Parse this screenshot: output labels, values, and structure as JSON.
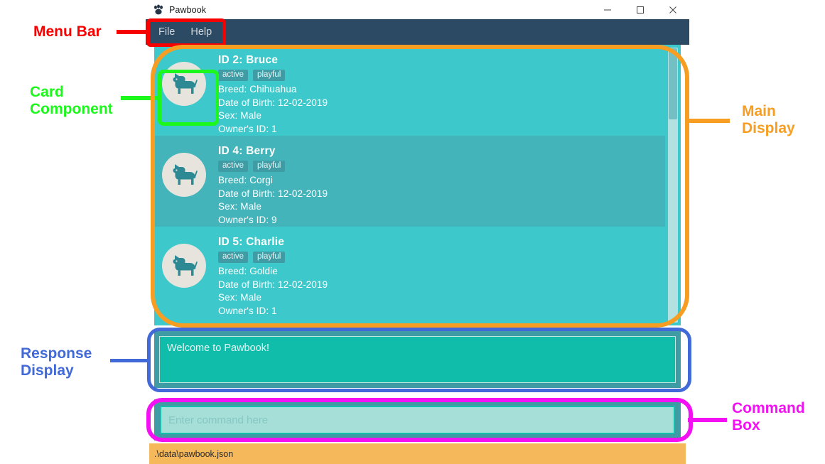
{
  "window": {
    "title": "Pawbook",
    "icon": "paw-icon",
    "controls": {
      "minimize": "–",
      "maximize": "☐",
      "close": "✕"
    }
  },
  "menu_bar": {
    "items": [
      {
        "label": "File"
      },
      {
        "label": "Help"
      }
    ]
  },
  "main_display": {
    "cards": [
      {
        "title": "ID 2:  Bruce",
        "tags": [
          "active",
          "playful"
        ],
        "breed": "Breed: Chihuahua",
        "dob": "Date of Birth: 12-02-2019",
        "sex": "Sex: Male",
        "owner": "Owner's ID: 1",
        "avatar": "dog-icon"
      },
      {
        "title": "ID 4:  Berry",
        "tags": [
          "active",
          "playful"
        ],
        "breed": "Breed: Corgi",
        "dob": "Date of Birth: 12-02-2019",
        "sex": "Sex: Male",
        "owner": "Owner's ID: 9",
        "avatar": "dog-icon"
      },
      {
        "title": "ID 5:  Charlie",
        "tags": [
          "active",
          "playful"
        ],
        "breed": "Breed: Goldie",
        "dob": "Date of Birth: 12-02-2019",
        "sex": "Sex: Male",
        "owner": "Owner's ID: 1",
        "avatar": "dog-icon"
      }
    ]
  },
  "response_display": {
    "text": "Welcome to Pawbook!"
  },
  "command_box": {
    "value": "",
    "placeholder": "Enter command here"
  },
  "status_bar": {
    "path": ".\\data\\pawbook.json"
  },
  "annotations": [
    {
      "label": "Menu Bar",
      "color": "#f60000"
    },
    {
      "label": "Card\nComponent",
      "color": "#1cf71c"
    },
    {
      "label": "Main\nDisplay",
      "color": "#f79d22"
    },
    {
      "label": "Response\nDisplay",
      "color": "#4169d8"
    },
    {
      "label": "Command\nBox",
      "color": "#f311f3"
    }
  ],
  "colors": {
    "menu_bar": "#2c4a63",
    "card_odd": "#3dc9cb",
    "card_even": "#44b4bb",
    "tag": "#3f9ca4",
    "response": "#0fbdaa",
    "command": "#a6ded8",
    "status": "#f5b95c"
  }
}
